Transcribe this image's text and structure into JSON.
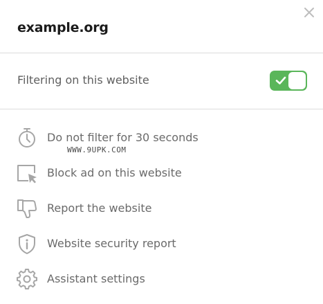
{
  "header": {
    "site": "example.org",
    "close_icon": "close-icon"
  },
  "filter": {
    "label": "Filtering on this website",
    "enabled": true,
    "toggle_color": "#5ab65a"
  },
  "menu": {
    "items": [
      {
        "label": "Do not filter for 30 seconds",
        "icon": "stopwatch-icon"
      },
      {
        "label": "Block ad on this website",
        "icon": "block-element-icon"
      },
      {
        "label": "Report the website",
        "icon": "thumbs-down-icon"
      },
      {
        "label": "Website security report",
        "icon": "shield-info-icon"
      },
      {
        "label": "Assistant settings",
        "icon": "gear-icon"
      }
    ]
  },
  "watermark": "WWW.9UPK.COM",
  "colors": {
    "icon_gray": "#a6a6a6",
    "text_gray": "#6a6a6a",
    "title": "#1b1b1b"
  }
}
